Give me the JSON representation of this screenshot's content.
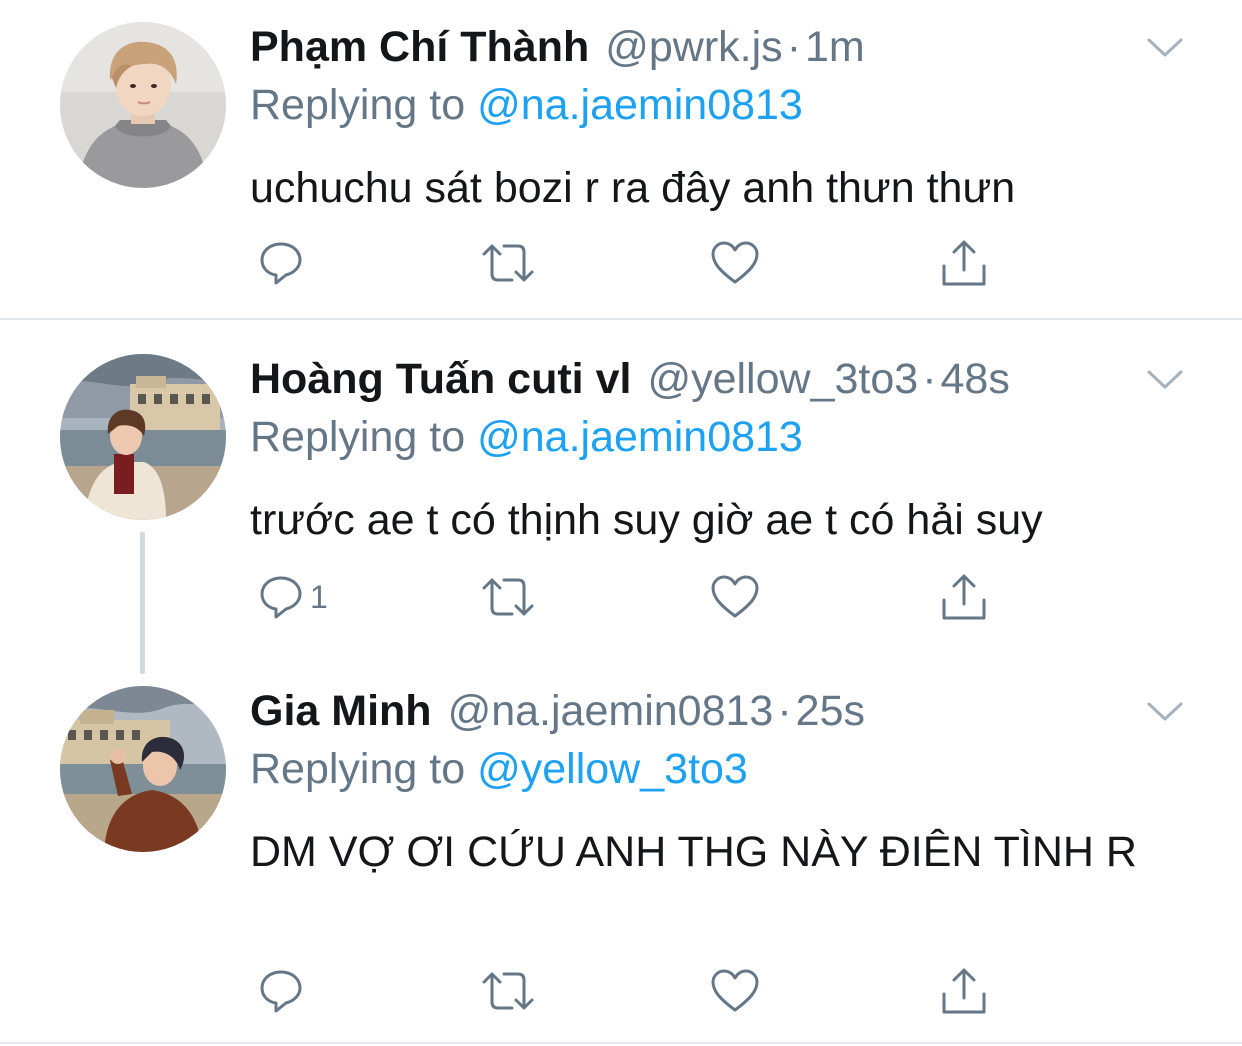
{
  "tweets": [
    {
      "name": "Phạm Chí Thành",
      "handle": "@pwrk.js",
      "separator": "·",
      "time": "1m",
      "replying_prefix": "Replying to",
      "replying_to": "@na.jaemin0813",
      "text": "uchuchu sát bozi r ra đây anh thưn thưn",
      "reply_count": ""
    },
    {
      "name": "Hoàng Tuấn cuti vl",
      "handle": "@yellow_3to3",
      "separator": "·",
      "time": "48s",
      "replying_prefix": "Replying to",
      "replying_to": "@na.jaemin0813",
      "text": "trước ae t có thịnh suy giờ ae t có hải suy",
      "reply_count": "1"
    },
    {
      "name": "Gia Minh",
      "handle": "@na.jaemin0813",
      "separator": "·",
      "time": "25s",
      "replying_prefix": "Replying to",
      "replying_to": "@yellow_3to3",
      "text": "DM VỢ ƠI CỨU ANH THG NÀY ĐIÊN TÌNH R",
      "reply_count": ""
    }
  ],
  "icons": {
    "reply": "reply-icon",
    "retweet": "retweet-icon",
    "like": "like-icon",
    "share": "share-icon",
    "menu": "chevron-down-icon"
  },
  "colors": {
    "name": "#14171a",
    "muted": "#657786",
    "mention": "#1da1f2",
    "divider": "#e1e8ed",
    "thread_line": "#cfd9de"
  }
}
